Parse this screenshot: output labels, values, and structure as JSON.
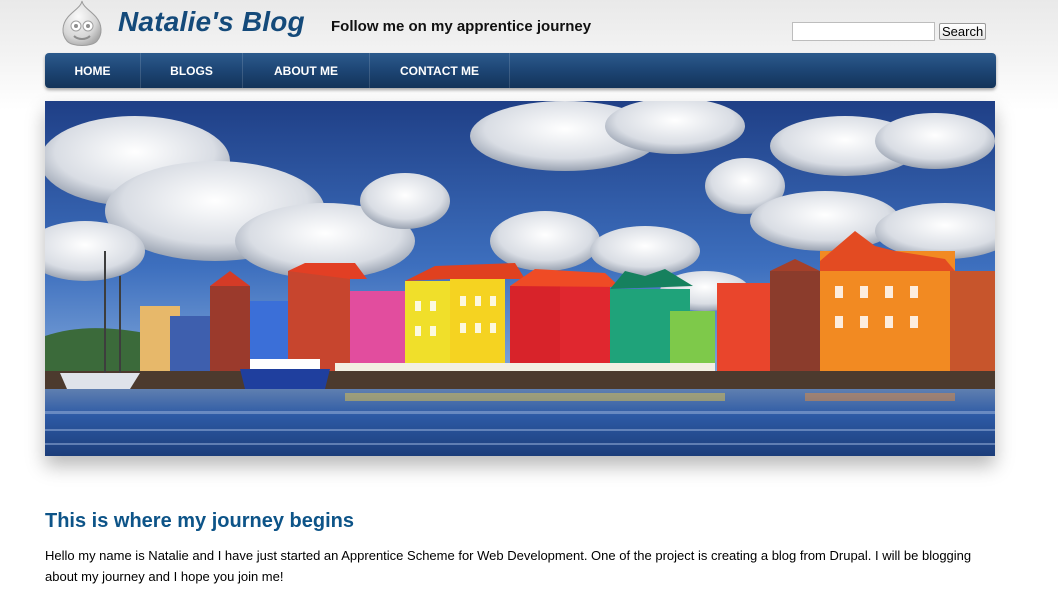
{
  "header": {
    "site_name": "Natalie's Blog",
    "slogan": "Follow me on my apprentice journey",
    "logo_icon": "drupal-drop-icon"
  },
  "search": {
    "placeholder": "",
    "value": "",
    "button_label": "Search"
  },
  "nav": {
    "items": [
      {
        "label": "HOME"
      },
      {
        "label": "BLOGS"
      },
      {
        "label": "ABOUT ME"
      },
      {
        "label": "CONTACT ME"
      }
    ]
  },
  "banner": {
    "image_alt": "Colorful waterfront buildings in Willemstad harbor"
  },
  "content": {
    "title": "This is where my journey begins",
    "body": "Hello my name is Natalie and I have just started an Apprentice Scheme for Web Development.  One of the project is creating a blog from Drupal.  I will be blogging about my journey and I hope you join me!"
  },
  "colors": {
    "brand_blue": "#144a7a",
    "title_blue": "#0d5488",
    "nav_top": "#2c5a8c",
    "nav_bottom": "#133459"
  }
}
